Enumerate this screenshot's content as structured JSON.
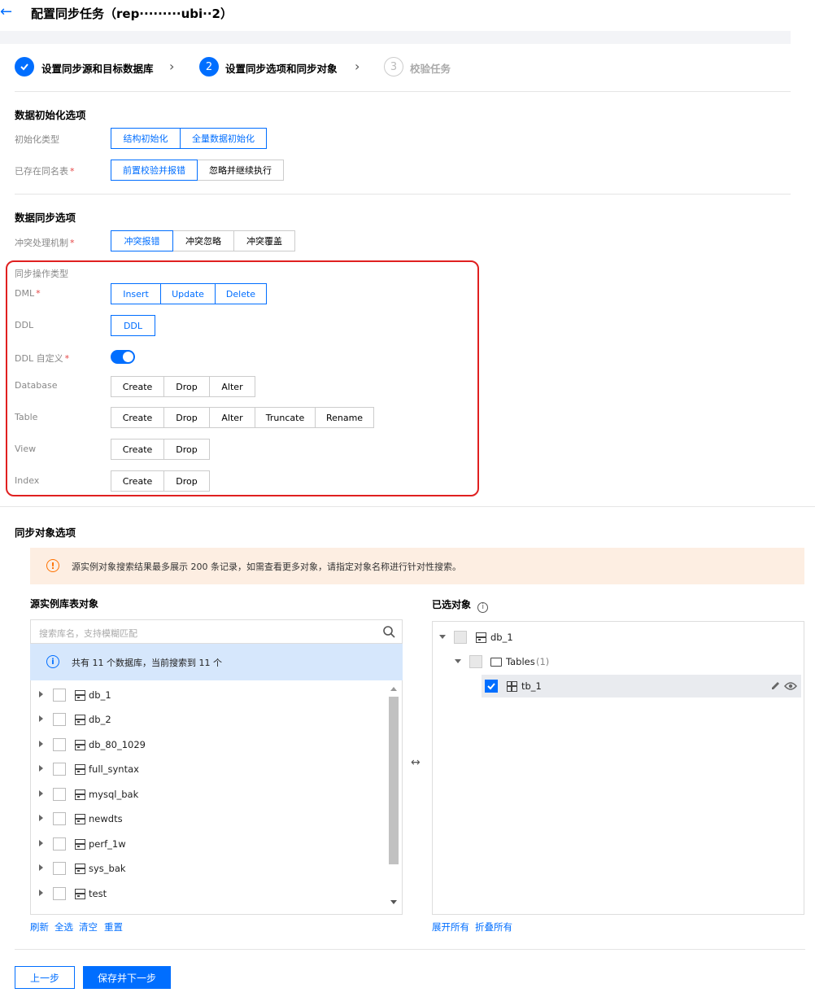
{
  "header": {
    "back_icon": "arrow-left-icon",
    "title": "配置同步任务（rep·········ubi··2）"
  },
  "steps": [
    {
      "index": "1",
      "label": "设置同步源和目标数据库",
      "state": "done"
    },
    {
      "index": "2",
      "label": "设置同步选项和同步对象",
      "state": "active"
    },
    {
      "index": "3",
      "label": "校验任务",
      "state": "pending"
    }
  ],
  "init_section": {
    "title": "数据初始化选项",
    "init_type_label": "初始化类型",
    "init_type_options": [
      "结构初始化",
      "全量数据初始化"
    ],
    "same_table_label": "已存在同名表",
    "same_table_options": [
      "前置校验并报错",
      "忽略并继续执行"
    ]
  },
  "sync_section": {
    "title": "数据同步选项",
    "conflict_label": "冲突处理机制",
    "conflict_options": [
      "冲突报错",
      "冲突忽略",
      "冲突覆盖"
    ],
    "op_type_label": "同步操作类型",
    "dml_label": "DML",
    "dml_options": [
      "Insert",
      "Update",
      "Delete"
    ],
    "ddl_label": "DDL",
    "ddl_options": [
      "DDL"
    ],
    "ddl_custom_label": "DDL 自定义",
    "database_label": "Database",
    "database_options": [
      "Create",
      "Drop",
      "Alter"
    ],
    "table_label": "Table",
    "table_options": [
      "Create",
      "Drop",
      "Alter",
      "Truncate",
      "Rename"
    ],
    "view_label": "View",
    "view_options": [
      "Create",
      "Drop"
    ],
    "index_label": "Index",
    "index_options": [
      "Create",
      "Drop"
    ]
  },
  "objects_section": {
    "title": "同步对象选项",
    "alert": "源实例对象搜索结果最多展示 200 条记录，如需查看更多对象，请指定对象名称进行针对性搜索。",
    "source_label": "源实例库表对象",
    "search_placeholder": "搜索库名，支持模糊匹配",
    "info": "共有 11 个数据库，当前搜索到 11 个",
    "databases": [
      "db_1",
      "db_2",
      "db_80_1029",
      "full_syntax",
      "mysql_bak",
      "newdts",
      "perf_1w",
      "sys_bak",
      "test"
    ],
    "source_actions": [
      "刷新",
      "全选",
      "清空",
      "重置"
    ],
    "selected_label": "已选对象",
    "selected_tree": {
      "db": "db_1",
      "folder": "Tables",
      "folder_count": "(1)",
      "table": "tb_1"
    },
    "selected_actions": [
      "展开所有",
      "折叠所有"
    ]
  },
  "footer": {
    "prev": "上一步",
    "next": "保存并下一步"
  },
  "colors": {
    "primary": "#006eff",
    "alert_bg": "#fdeee2",
    "info_bg": "#d6e7fc",
    "highlight": "#e02020"
  }
}
